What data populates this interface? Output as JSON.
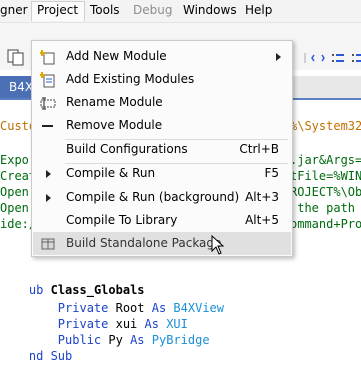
{
  "menubar": {
    "items": [
      {
        "label": "gner",
        "state": "normal"
      },
      {
        "label": "Project",
        "state": "open"
      },
      {
        "label": "Tools",
        "state": "normal"
      },
      {
        "label": "Debug",
        "state": "disabled"
      },
      {
        "label": "Windows",
        "state": "normal"
      },
      {
        "label": "Help",
        "state": "normal"
      }
    ]
  },
  "tab": {
    "label": "B4X"
  },
  "project_menu": {
    "items": [
      {
        "label": "Add New Module",
        "shortcut": "",
        "icon": "add-new-module-icon",
        "submenu": true
      },
      {
        "label": "Add Existing Modules",
        "shortcut": "",
        "icon": "add-existing-modules-icon",
        "submenu": false
      },
      {
        "label": "Rename Module",
        "shortcut": "",
        "icon": "rename-icon",
        "submenu": false
      },
      {
        "label": "Remove Module",
        "shortcut": "",
        "icon": "remove-icon",
        "submenu": false
      },
      {
        "label": "Build Configurations",
        "shortcut": "Ctrl+B",
        "icon": "",
        "submenu": false
      },
      {
        "label": "Compile & Run",
        "shortcut": "F5",
        "icon": "play-icon",
        "submenu": false
      },
      {
        "label": "Compile & Run (background)",
        "shortcut": "Alt+3",
        "icon": "play-icon",
        "submenu": false
      },
      {
        "label": "Compile To Library",
        "shortcut": "Alt+5",
        "icon": "",
        "submenu": false
      },
      {
        "label": "Build Standalone Package",
        "shortcut": "",
        "icon": "package-icon",
        "submenu": false,
        "hover": true
      }
    ]
  },
  "editor": {
    "left_fragments": [
      {
        "text": "Custo",
        "color": "brown"
      },
      {
        "text": "Expor",
        "color": "green"
      },
      {
        "text": "Creat",
        "color": "green"
      },
      {
        "text": "Open ",
        "color": "green"
      },
      {
        "text": "Open ",
        "color": "green"
      },
      {
        "text": "ide:/",
        "color": "green"
      }
    ],
    "right_fragments": [
      {
        "text": "%\\System32",
        "color": "brown"
      },
      {
        "text": ".jar&Args=",
        "color": "green"
      },
      {
        "text": "tFile=%WIN",
        "color": "green"
      },
      {
        "text": "ROJECT%\\Ob",
        "color": "green"
      },
      {
        "text": " the path",
        "color": "green"
      },
      {
        "text": "ommand+Pro",
        "color": "green"
      }
    ],
    "code": [
      {
        "parts": [
          {
            "t": "ub ",
            "c": "kw"
          },
          {
            "t": "Class_Globals",
            "c": "sub"
          }
        ]
      },
      {
        "parts": [
          {
            "t": "    Private ",
            "c": "kw"
          },
          {
            "t": "Root ",
            "c": "plain"
          },
          {
            "t": "As ",
            "c": "kw"
          },
          {
            "t": "B4XView",
            "c": "ty"
          }
        ]
      },
      {
        "parts": [
          {
            "t": "    Private ",
            "c": "kw"
          },
          {
            "t": "xui ",
            "c": "plain"
          },
          {
            "t": "As ",
            "c": "kw"
          },
          {
            "t": "XUI",
            "c": "ty"
          }
        ]
      },
      {
        "parts": [
          {
            "t": "    Public ",
            "c": "kw"
          },
          {
            "t": "Py ",
            "c": "plain"
          },
          {
            "t": "As ",
            "c": "kw"
          },
          {
            "t": "PyBridge",
            "c": "ty"
          }
        ]
      },
      {
        "parts": [
          {
            "t": "nd Sub",
            "c": "kw"
          }
        ]
      }
    ]
  }
}
